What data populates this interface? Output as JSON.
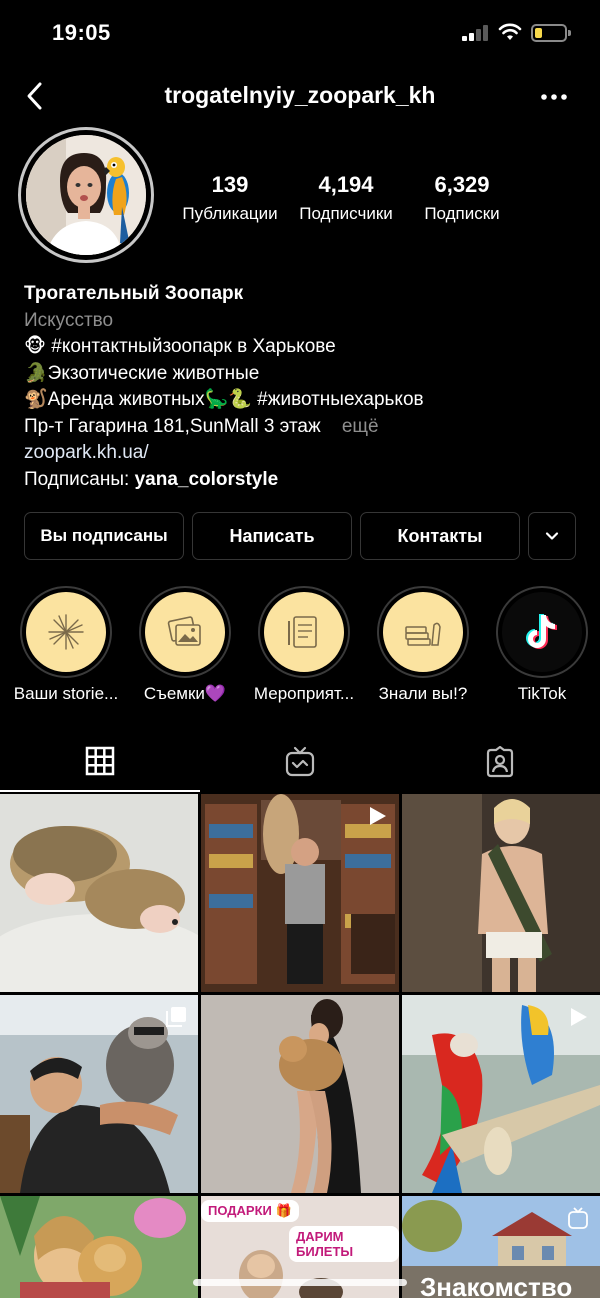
{
  "status_bar": {
    "time": "19:05",
    "battery_level": 0.25,
    "battery_color": "#f7d94c"
  },
  "header": {
    "username": "trogatelnyiy_zoopark_kh",
    "back_icon": "chevron-left-icon",
    "more_icon": "more-horizontal-icon"
  },
  "stats": {
    "posts": {
      "value": "139",
      "label": "Публикации"
    },
    "followers": {
      "value": "4,194",
      "label": "Подписчики"
    },
    "following": {
      "value": "6,329",
      "label": "Подписки"
    }
  },
  "bio": {
    "name": "Трогательный Зоопарк",
    "category": "Искусство",
    "line1": "🐵 #контактныйзоопарк  в Харькове",
    "line2": "🐊Экзотические животные",
    "line3": "🐒Аренда животных🦕🐍 #животныехарьков",
    "line4": "Пр-т Гагарина 181,SunMall 3 этаж",
    "more": "ещё",
    "link": "zoopark.kh.ua/",
    "followed_by_prefix": "Подписаны: ",
    "followed_by_user": "yana_colorstyle"
  },
  "actions": {
    "following": "Вы подписаны",
    "message": "Написать",
    "contacts": "Контакты",
    "dropdown_icon": "chevron-down-icon"
  },
  "highlights": [
    {
      "label": "Ваши storie...",
      "icon": "fireworks-icon"
    },
    {
      "label": "Съемки💜",
      "icon": "photos-icon"
    },
    {
      "label": "Мероприят...",
      "icon": "notepad-icon"
    },
    {
      "label": "Знали вы!?",
      "icon": "books-icon"
    },
    {
      "label": "TikTok",
      "icon": "tiktok-icon"
    }
  ],
  "tabs": [
    {
      "name": "grid",
      "icon": "grid-icon",
      "active": true
    },
    {
      "name": "igtv",
      "icon": "igtv-icon",
      "active": false
    },
    {
      "name": "tagged",
      "icon": "tagged-icon",
      "active": false
    }
  ],
  "posts": [
    {
      "subject": "hedgehogs",
      "badge": ""
    },
    {
      "subject": "lynx-library",
      "badge": "video-icon"
    },
    {
      "subject": "woman-crocodile",
      "badge": ""
    },
    {
      "subject": "man-raccoon",
      "badge": "carousel-icon"
    },
    {
      "subject": "woman-lion-cub",
      "badge": ""
    },
    {
      "subject": "macaw-parrots",
      "badge": "video-icon"
    },
    {
      "subject": "woman-lion-cub-2",
      "badge": ""
    },
    {
      "subject": "gift-promo",
      "badge": ""
    },
    {
      "subject": "street-promo",
      "badge": "igtv-icon"
    }
  ],
  "promo_texts": {
    "gifts": "ПОДАРКИ 🎁",
    "tickets": "ДАРИМ БИЛЕТЫ",
    "intro": "Знакомство"
  },
  "colors": {
    "background": "#000000",
    "highlight_fill": "#fbe3a0",
    "button_border": "#363636",
    "muted_text": "#8e8e8e"
  }
}
